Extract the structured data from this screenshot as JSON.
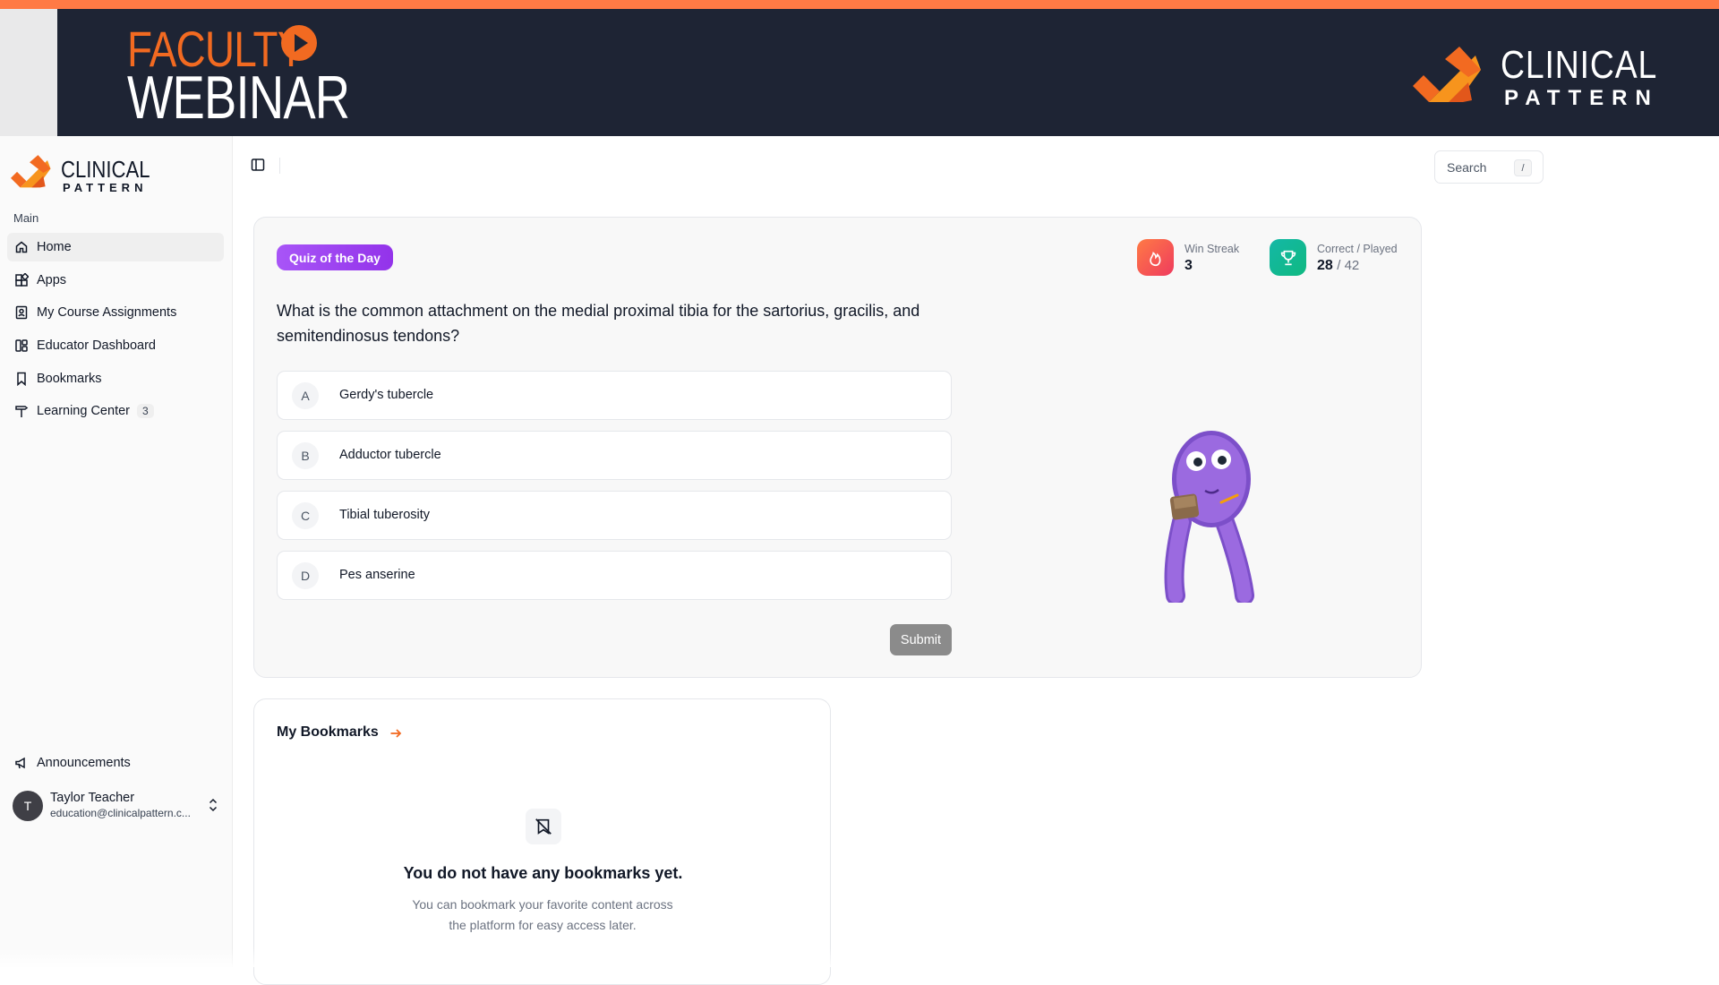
{
  "banner": {
    "faculty_label": "FACULTY",
    "webinar_label": "WEBINAR",
    "brand_line1": "CLINICAL",
    "brand_line2": "PATTERN",
    "colors": {
      "navy": "#1e2434",
      "orange": "#f26a21"
    }
  },
  "sidebar": {
    "brand_line1": "CLINICAL",
    "brand_line2": "PATTERN",
    "section_label": "Main",
    "items": [
      {
        "label": "Home",
        "icon": "home-icon",
        "active": true
      },
      {
        "label": "Apps",
        "icon": "apps-icon"
      },
      {
        "label": "My Course Assignments",
        "icon": "assignment-icon"
      },
      {
        "label": "Educator Dashboard",
        "icon": "dashboard-icon"
      },
      {
        "label": "Bookmarks",
        "icon": "bookmark-icon"
      },
      {
        "label": "Learning Center",
        "icon": "signpost-icon",
        "badge": "3"
      }
    ],
    "announcements_label": "Announcements",
    "user": {
      "initial": "T",
      "name": "Taylor Teacher",
      "email": "education@clinicalpattern.c..."
    }
  },
  "topbar": {
    "search_placeholder": "Search",
    "search_shortcut": "/"
  },
  "quiz": {
    "badge": "Quiz of the Day",
    "question": "What is the common attachment on the medial proximal tibia for the sartorius, gracilis, and semitendinosus tendons?",
    "answers": [
      {
        "letter": "A",
        "text": "Gerdy's tubercle"
      },
      {
        "letter": "B",
        "text": "Adductor tubercle"
      },
      {
        "letter": "C",
        "text": "Tibial tuberosity"
      },
      {
        "letter": "D",
        "text": "Pes anserine"
      }
    ],
    "submit_label": "Submit",
    "win_streak": {
      "label": "Win Streak",
      "value": "3"
    },
    "correct_played": {
      "label": "Correct / Played",
      "correct": "28",
      "played": "/ 42"
    },
    "colors": {
      "badge": "#9333ea",
      "streak": "#f2542d",
      "trophy": "#14b8a6"
    }
  },
  "bookmarks": {
    "title": "My Bookmarks",
    "empty_title": "You do not have any bookmarks yet.",
    "empty_desc": "You can bookmark your favorite content across the platform for easy access later."
  }
}
